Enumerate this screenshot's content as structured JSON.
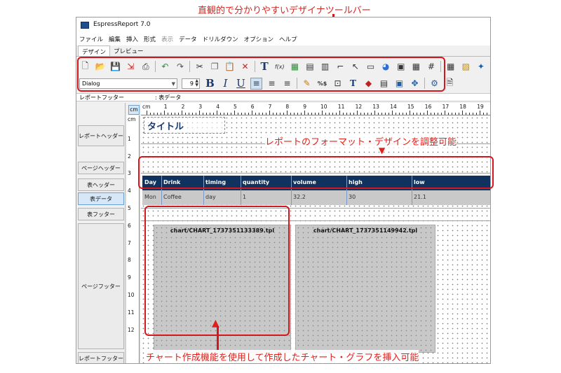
{
  "annotations": {
    "toolbar_note": "直観的で分かりやすいデザイナツールバー",
    "format_note": "レポートのフォーマット・デザインを調整可能",
    "chart_note": "チャート作成機能を使用して作成したチャート・グラフを挿入可能"
  },
  "window": {
    "title": "EspressReport 7.0"
  },
  "menu": [
    {
      "label": "ファイル",
      "enabled": true
    },
    {
      "label": "編集",
      "enabled": true
    },
    {
      "label": "挿入",
      "enabled": true
    },
    {
      "label": "形式",
      "enabled": true
    },
    {
      "label": "表示",
      "enabled": false
    },
    {
      "label": "データ",
      "enabled": true
    },
    {
      "label": "ドリルダウン",
      "enabled": true
    },
    {
      "label": "オプション",
      "enabled": true
    },
    {
      "label": "ヘルプ",
      "enabled": true
    }
  ],
  "tabs": [
    {
      "label": "デザイン"
    },
    {
      "label": "プレビュー"
    }
  ],
  "toolbar": {
    "font_name": "Dialog",
    "font_size": "9",
    "bold": "B",
    "italic": "I",
    "underline": "U",
    "text_glyph": "T",
    "formula_glyph": "f(x)",
    "currency_glyph": "%$"
  },
  "status": {
    "section": "レポートフッター",
    "selected": ": 表データ"
  },
  "sections": [
    {
      "label": "レポートヘッダー"
    },
    {
      "label": "ページヘッダー"
    },
    {
      "label": "表ヘッダー"
    },
    {
      "label": "表データ"
    },
    {
      "label": "表フッター"
    },
    {
      "label": "ページフッター"
    },
    {
      "label": "レポートフッター"
    }
  ],
  "ruler": {
    "unit": "cm",
    "top_numbers": [
      "cm",
      "1",
      "2",
      "3",
      "4",
      "5",
      "6",
      "7",
      "8",
      "9",
      "10",
      "11",
      "12",
      "13",
      "14",
      "15",
      "16",
      "17",
      "18",
      "19"
    ],
    "left_numbers": [
      "cm",
      "1",
      "2",
      "3",
      "4",
      "5",
      "6",
      "7",
      "8",
      "9",
      "10",
      "11",
      "12"
    ]
  },
  "report": {
    "title": "タイトル",
    "columns": [
      "Day",
      "Drink",
      "timing",
      "quantity",
      "volume",
      "high",
      "low"
    ],
    "row": [
      "Mon",
      "Coffee",
      "day",
      "1",
      "32.2",
      "30",
      "21.1"
    ],
    "charts": [
      {
        "file": "chart/CHART_1737351133389.tpl"
      },
      {
        "file": "chart/CHART_1737351149942.tpl"
      }
    ]
  },
  "colors": {
    "annotation": "#e0211b",
    "header_band": "#10325e",
    "data_band": "#c9c9c9",
    "chart_bg": "#c8c8c8"
  }
}
